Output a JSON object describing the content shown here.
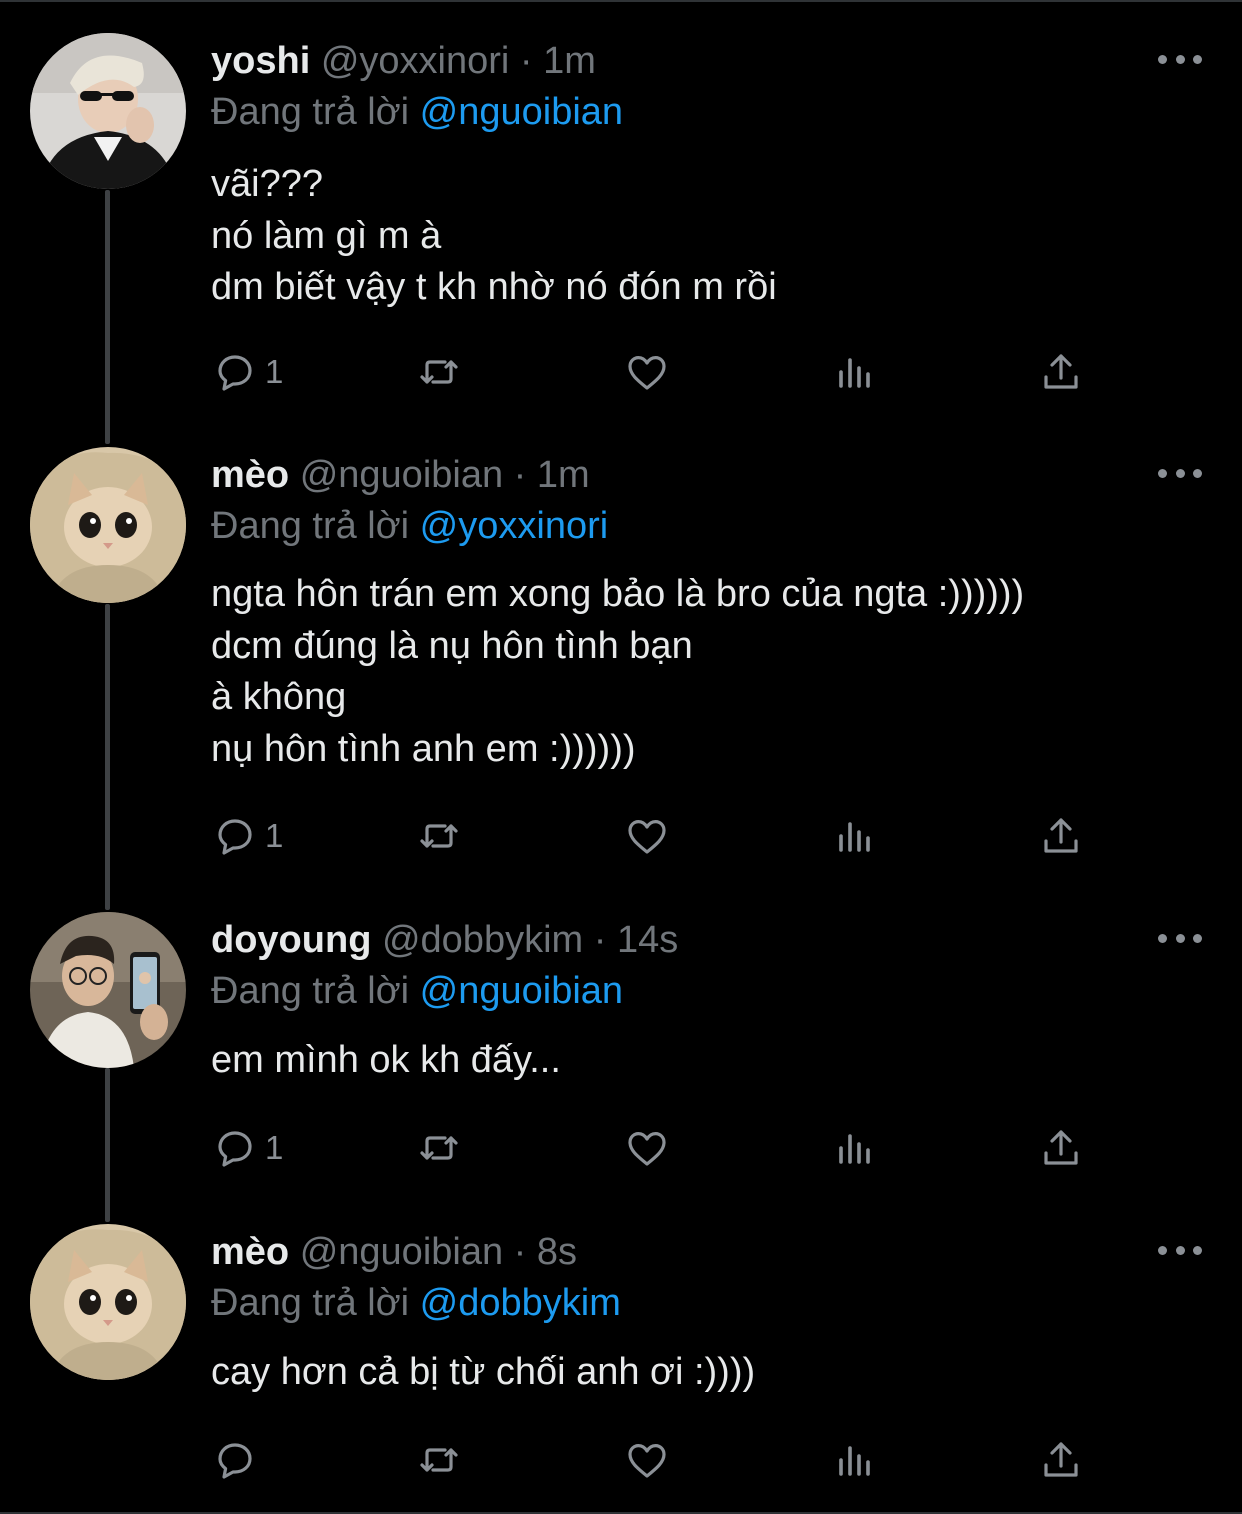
{
  "thread": {
    "reply_prefix": "Đang trả lời",
    "tweets": [
      {
        "name": "yoshi",
        "handle": "@yoxxinori",
        "time": "1m",
        "reply_to": "@nguoibian",
        "lines": [
          "vãi???",
          "nó làm gì m à",
          "dm biết vậy t kh nhờ nó đón m rồi"
        ],
        "reply_count": "1",
        "avatar": "user-photo-sunglasses"
      },
      {
        "name": "mèo",
        "handle": "@nguoibian",
        "time": "1m",
        "reply_to": "@yoxxinori",
        "lines": [
          "ngta hôn trán em xong bảo là bro của ngta :))))))",
          "dcm đúng là nụ hôn tình bạn",
          "à không",
          "nụ hôn tình anh em :))))))"
        ],
        "reply_count": "1",
        "avatar": "cat-photo"
      },
      {
        "name": "doyoung",
        "handle": "@dobbykim",
        "time": "14s",
        "reply_to": "@nguoibian",
        "lines": [
          "em mình ok kh đấy..."
        ],
        "reply_count": "1",
        "avatar": "user-photo-phone"
      },
      {
        "name": "mèo",
        "handle": "@nguoibian",
        "time": "8s",
        "reply_to": "@dobbykim",
        "lines": [
          "cay hơn cả bị từ chối anh ơi :))))"
        ],
        "reply_count": "",
        "avatar": "cat-photo"
      }
    ]
  },
  "colors": {
    "background": "#000000",
    "text": "#e7e9ea",
    "secondary": "#71767b",
    "accent": "#1d9bf0"
  }
}
